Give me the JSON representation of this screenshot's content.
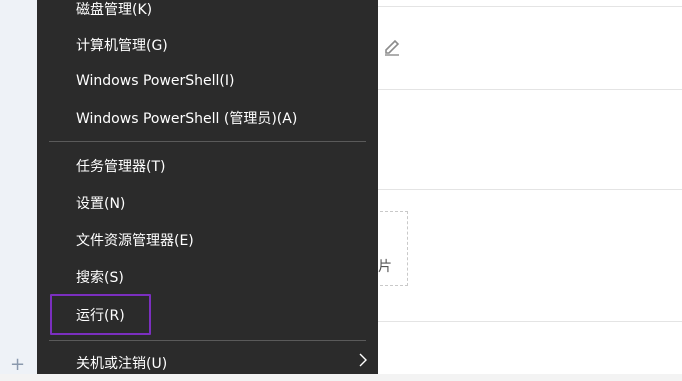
{
  "menu": {
    "items": [
      {
        "label": "磁盘管理(K)"
      },
      {
        "label": "计算机管理(G)"
      },
      {
        "label": "Windows PowerShell(I)"
      },
      {
        "label": "Windows PowerShell (管理员)(A)"
      },
      {
        "label": "任务管理器(T)"
      },
      {
        "label": "设置(N)"
      },
      {
        "label": "文件资源管理器(E)"
      },
      {
        "label": "搜索(S)"
      },
      {
        "label": "运行(R)"
      },
      {
        "label": "关机或注销(U)"
      }
    ],
    "highlight_color": "#7b2fbf",
    "submenu_icon": "chevron-right-icon"
  },
  "background": {
    "upload_text": "图片",
    "icons": [
      "edit-icon",
      "plus-icon"
    ]
  }
}
